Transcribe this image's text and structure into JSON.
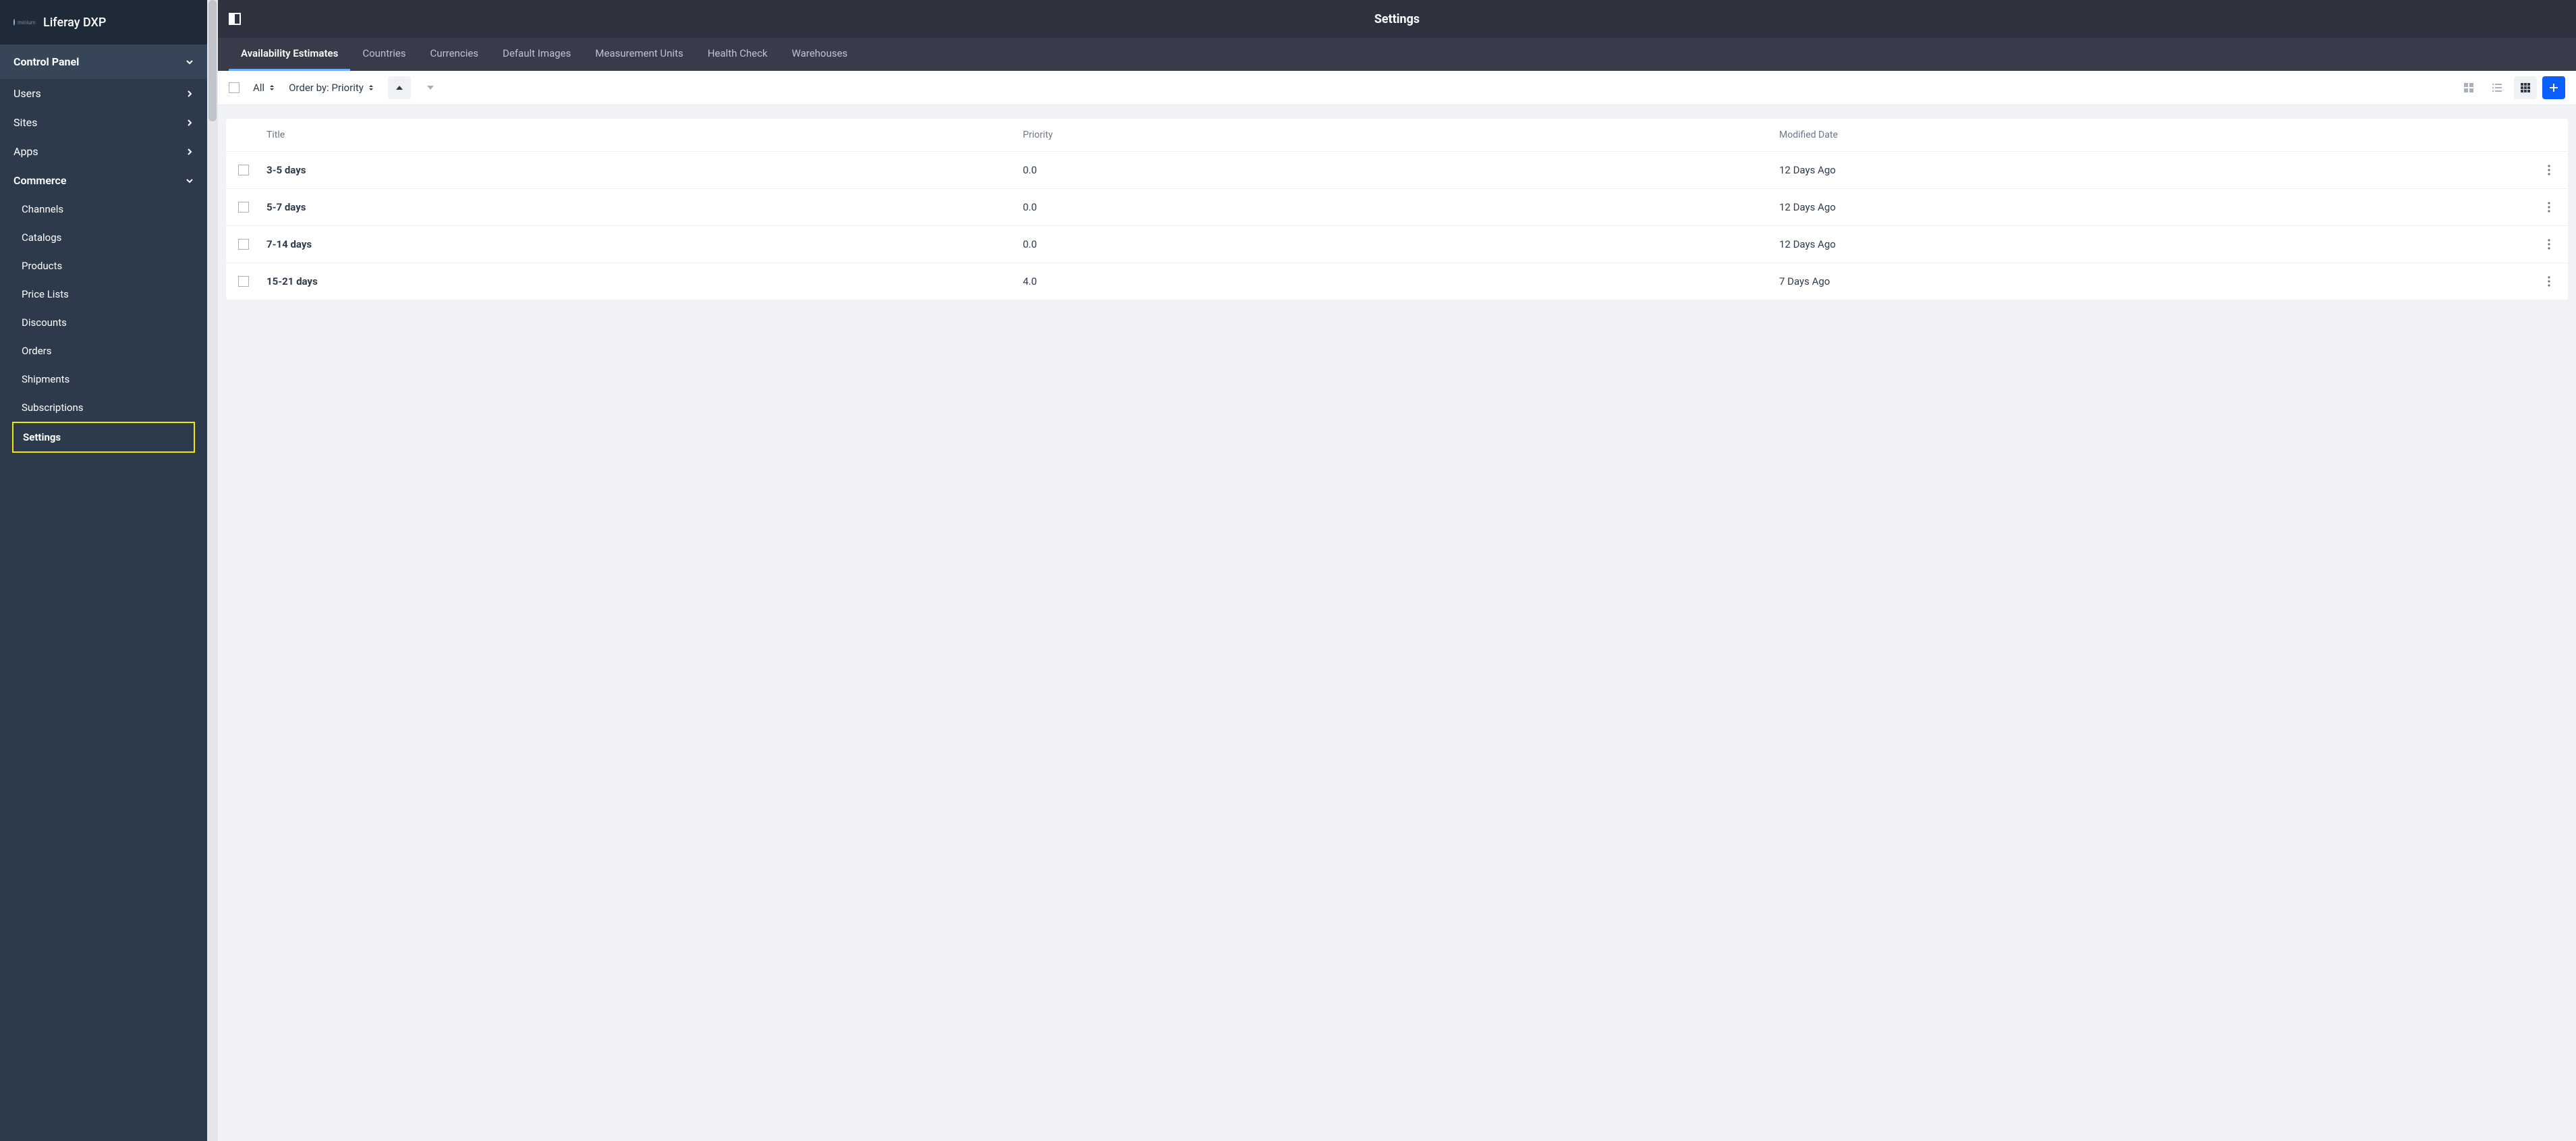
{
  "brand": "Liferay DXP",
  "logo_subtext": "minium",
  "sidebar": {
    "heading": "Control Panel",
    "items": [
      {
        "label": "Users"
      },
      {
        "label": "Sites"
      },
      {
        "label": "Apps"
      }
    ],
    "commerce_heading": "Commerce",
    "commerce_items": [
      {
        "label": "Channels"
      },
      {
        "label": "Catalogs"
      },
      {
        "label": "Products"
      },
      {
        "label": "Price Lists"
      },
      {
        "label": "Discounts"
      },
      {
        "label": "Orders"
      },
      {
        "label": "Shipments"
      },
      {
        "label": "Subscriptions"
      },
      {
        "label": "Settings"
      }
    ]
  },
  "header": {
    "title": "Settings"
  },
  "tabs": [
    "Availability Estimates",
    "Countries",
    "Currencies",
    "Default Images",
    "Measurement Units",
    "Health Check",
    "Warehouses"
  ],
  "toolbar": {
    "filter_label": "All",
    "order_label": "Order by: Priority"
  },
  "table": {
    "columns": {
      "title": "Title",
      "priority": "Priority",
      "modified": "Modified Date"
    },
    "rows": [
      {
        "title": "3-5 days",
        "priority": "0.0",
        "modified": "12 Days Ago"
      },
      {
        "title": "5-7 days",
        "priority": "0.0",
        "modified": "12 Days Ago"
      },
      {
        "title": "7-14 days",
        "priority": "0.0",
        "modified": "12 Days Ago"
      },
      {
        "title": "15-21 days",
        "priority": "4.0",
        "modified": "7 Days Ago"
      }
    ]
  }
}
